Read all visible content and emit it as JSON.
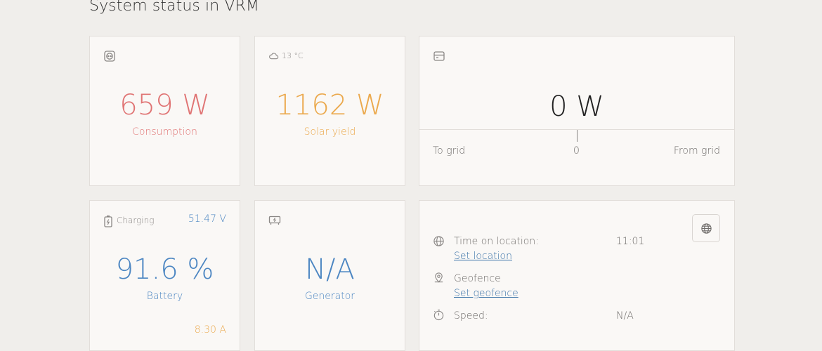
{
  "page": {
    "title": "System status in VRM"
  },
  "colors": {
    "consumption": "#e07474",
    "solar": "#eba94d",
    "battery": "#4c86c2",
    "current": "#eba94d",
    "link": "#3b73a8"
  },
  "consumption": {
    "icon": "socket-icon",
    "value": "659 W",
    "label": "Consumption"
  },
  "solar": {
    "icon": "cloud-icon",
    "temperature": "13 °C",
    "value": "1162 W",
    "label": "Solar yield"
  },
  "grid": {
    "icon": "grid-meter-icon",
    "value": "0 W",
    "to_grid": "To grid",
    "center": "0",
    "from_grid": "From grid"
  },
  "battery": {
    "icon": "battery-icon",
    "state": "Charging",
    "voltage": "51.47 V",
    "value": "91.6 %",
    "label": "Battery",
    "current": "8.30 A"
  },
  "generator": {
    "icon": "generator-icon",
    "value": "N/A",
    "label": "Generator"
  },
  "location": {
    "time_label": "Time on location:",
    "time_value": "11:01",
    "set_location": "Set location",
    "geofence_label": "Geofence",
    "set_geofence": "Set geofence",
    "speed_label": "Speed:",
    "speed_value": "N/A"
  }
}
